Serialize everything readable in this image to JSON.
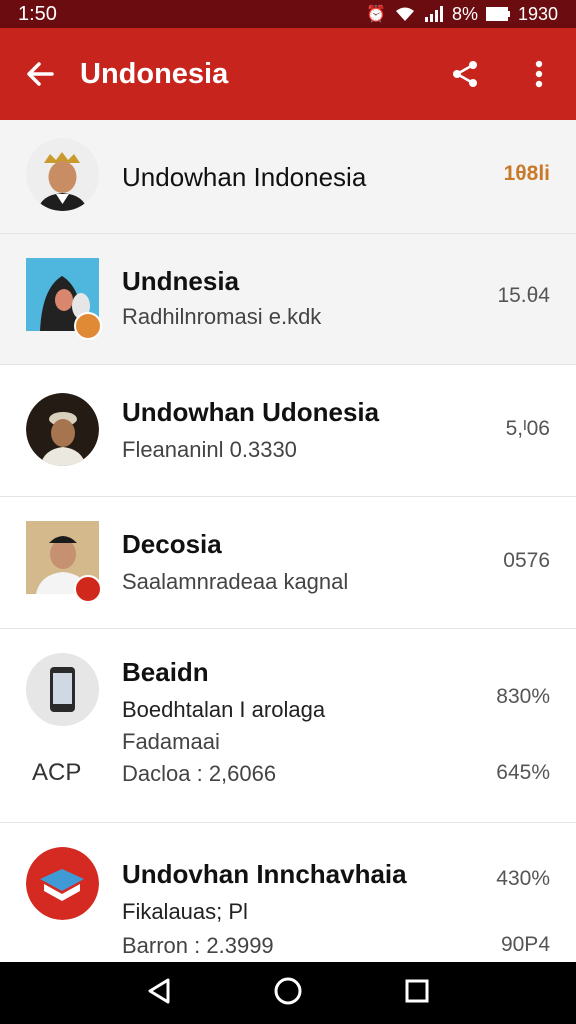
{
  "status_bar": {
    "time": "1:50",
    "battery": "8%",
    "clock_right": "1930"
  },
  "app_bar": {
    "title": "Undonesia"
  },
  "rows": [
    {
      "title": "Undowhan Indonesia",
      "value": "1θ8li",
      "accent": "#c87a2a"
    },
    {
      "title": "Undnesia",
      "subtitle": "Radhilnromasi e.kdk",
      "value": "15.θ4"
    },
    {
      "title": "Undowhan Udonesia",
      "subtitle": "Fleananinl 0.3330",
      "value": "5,ᴵ06"
    },
    {
      "title": "Decosia",
      "subtitle": "Saalamnradeaa kagnal",
      "value": "0576"
    },
    {
      "title": "Beaidn",
      "subtitle": "Boedhtalan I arolaga",
      "subtitle2": "Fadamaai",
      "side_tag": "ACP",
      "detail": "Dacloa : 2,6066",
      "value": "830%",
      "value2": "645%"
    },
    {
      "title": "Undovhan Innchavhaia",
      "subtitle": "Fikalauas; Pl",
      "detail": "Barron : 2.3999",
      "value": "430%",
      "value2": "90P4"
    }
  ],
  "icons": {
    "back": "arrow-back-icon",
    "share": "share-icon",
    "more": "more-vert-icon",
    "nav_back": "triangle-back-icon",
    "nav_home": "circle-home-icon",
    "nav_recents": "square-recents-icon"
  },
  "colors": {
    "status_bar": "#6b0d10",
    "app_bar": "#c8241e"
  }
}
